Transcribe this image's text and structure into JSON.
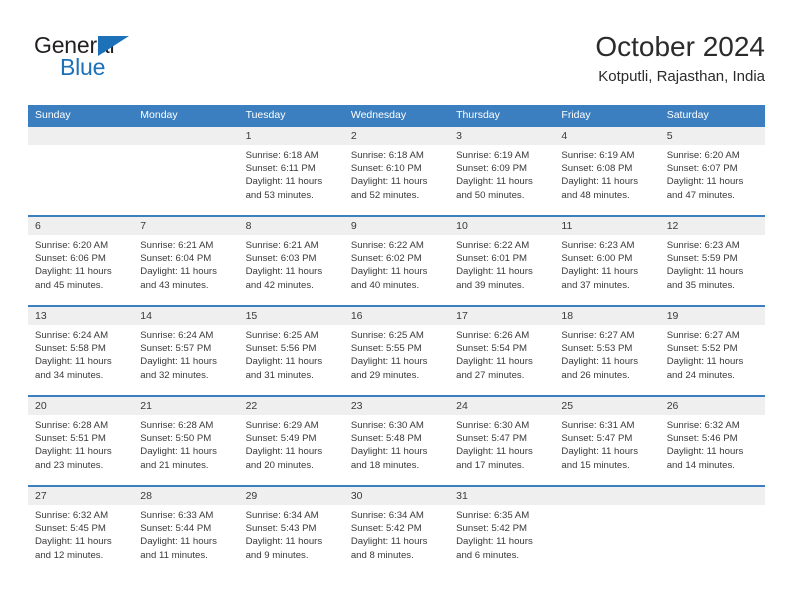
{
  "brand": {
    "name_part1": "General",
    "name_part2": "Blue",
    "color_primary": "#1c71b9"
  },
  "header": {
    "title": "October 2024",
    "subtitle": "Kotputli, Rajasthan, India"
  },
  "theme": {
    "header_blue": "#3c7fc0",
    "daynum_band": "#efefef",
    "text": "#3a3a3a"
  },
  "weekdays": [
    "Sunday",
    "Monday",
    "Tuesday",
    "Wednesday",
    "Thursday",
    "Friday",
    "Saturday"
  ],
  "weeks": [
    [
      {
        "day": "",
        "sunrise": "",
        "sunset": "",
        "daylight": ""
      },
      {
        "day": "",
        "sunrise": "",
        "sunset": "",
        "daylight": ""
      },
      {
        "day": "1",
        "sunrise": "Sunrise: 6:18 AM",
        "sunset": "Sunset: 6:11 PM",
        "daylight": "Daylight: 11 hours and 53 minutes."
      },
      {
        "day": "2",
        "sunrise": "Sunrise: 6:18 AM",
        "sunset": "Sunset: 6:10 PM",
        "daylight": "Daylight: 11 hours and 52 minutes."
      },
      {
        "day": "3",
        "sunrise": "Sunrise: 6:19 AM",
        "sunset": "Sunset: 6:09 PM",
        "daylight": "Daylight: 11 hours and 50 minutes."
      },
      {
        "day": "4",
        "sunrise": "Sunrise: 6:19 AM",
        "sunset": "Sunset: 6:08 PM",
        "daylight": "Daylight: 11 hours and 48 minutes."
      },
      {
        "day": "5",
        "sunrise": "Sunrise: 6:20 AM",
        "sunset": "Sunset: 6:07 PM",
        "daylight": "Daylight: 11 hours and 47 minutes."
      }
    ],
    [
      {
        "day": "6",
        "sunrise": "Sunrise: 6:20 AM",
        "sunset": "Sunset: 6:06 PM",
        "daylight": "Daylight: 11 hours and 45 minutes."
      },
      {
        "day": "7",
        "sunrise": "Sunrise: 6:21 AM",
        "sunset": "Sunset: 6:04 PM",
        "daylight": "Daylight: 11 hours and 43 minutes."
      },
      {
        "day": "8",
        "sunrise": "Sunrise: 6:21 AM",
        "sunset": "Sunset: 6:03 PM",
        "daylight": "Daylight: 11 hours and 42 minutes."
      },
      {
        "day": "9",
        "sunrise": "Sunrise: 6:22 AM",
        "sunset": "Sunset: 6:02 PM",
        "daylight": "Daylight: 11 hours and 40 minutes."
      },
      {
        "day": "10",
        "sunrise": "Sunrise: 6:22 AM",
        "sunset": "Sunset: 6:01 PM",
        "daylight": "Daylight: 11 hours and 39 minutes."
      },
      {
        "day": "11",
        "sunrise": "Sunrise: 6:23 AM",
        "sunset": "Sunset: 6:00 PM",
        "daylight": "Daylight: 11 hours and 37 minutes."
      },
      {
        "day": "12",
        "sunrise": "Sunrise: 6:23 AM",
        "sunset": "Sunset: 5:59 PM",
        "daylight": "Daylight: 11 hours and 35 minutes."
      }
    ],
    [
      {
        "day": "13",
        "sunrise": "Sunrise: 6:24 AM",
        "sunset": "Sunset: 5:58 PM",
        "daylight": "Daylight: 11 hours and 34 minutes."
      },
      {
        "day": "14",
        "sunrise": "Sunrise: 6:24 AM",
        "sunset": "Sunset: 5:57 PM",
        "daylight": "Daylight: 11 hours and 32 minutes."
      },
      {
        "day": "15",
        "sunrise": "Sunrise: 6:25 AM",
        "sunset": "Sunset: 5:56 PM",
        "daylight": "Daylight: 11 hours and 31 minutes."
      },
      {
        "day": "16",
        "sunrise": "Sunrise: 6:25 AM",
        "sunset": "Sunset: 5:55 PM",
        "daylight": "Daylight: 11 hours and 29 minutes."
      },
      {
        "day": "17",
        "sunrise": "Sunrise: 6:26 AM",
        "sunset": "Sunset: 5:54 PM",
        "daylight": "Daylight: 11 hours and 27 minutes."
      },
      {
        "day": "18",
        "sunrise": "Sunrise: 6:27 AM",
        "sunset": "Sunset: 5:53 PM",
        "daylight": "Daylight: 11 hours and 26 minutes."
      },
      {
        "day": "19",
        "sunrise": "Sunrise: 6:27 AM",
        "sunset": "Sunset: 5:52 PM",
        "daylight": "Daylight: 11 hours and 24 minutes."
      }
    ],
    [
      {
        "day": "20",
        "sunrise": "Sunrise: 6:28 AM",
        "sunset": "Sunset: 5:51 PM",
        "daylight": "Daylight: 11 hours and 23 minutes."
      },
      {
        "day": "21",
        "sunrise": "Sunrise: 6:28 AM",
        "sunset": "Sunset: 5:50 PM",
        "daylight": "Daylight: 11 hours and 21 minutes."
      },
      {
        "day": "22",
        "sunrise": "Sunrise: 6:29 AM",
        "sunset": "Sunset: 5:49 PM",
        "daylight": "Daylight: 11 hours and 20 minutes."
      },
      {
        "day": "23",
        "sunrise": "Sunrise: 6:30 AM",
        "sunset": "Sunset: 5:48 PM",
        "daylight": "Daylight: 11 hours and 18 minutes."
      },
      {
        "day": "24",
        "sunrise": "Sunrise: 6:30 AM",
        "sunset": "Sunset: 5:47 PM",
        "daylight": "Daylight: 11 hours and 17 minutes."
      },
      {
        "day": "25",
        "sunrise": "Sunrise: 6:31 AM",
        "sunset": "Sunset: 5:47 PM",
        "daylight": "Daylight: 11 hours and 15 minutes."
      },
      {
        "day": "26",
        "sunrise": "Sunrise: 6:32 AM",
        "sunset": "Sunset: 5:46 PM",
        "daylight": "Daylight: 11 hours and 14 minutes."
      }
    ],
    [
      {
        "day": "27",
        "sunrise": "Sunrise: 6:32 AM",
        "sunset": "Sunset: 5:45 PM",
        "daylight": "Daylight: 11 hours and 12 minutes."
      },
      {
        "day": "28",
        "sunrise": "Sunrise: 6:33 AM",
        "sunset": "Sunset: 5:44 PM",
        "daylight": "Daylight: 11 hours and 11 minutes."
      },
      {
        "day": "29",
        "sunrise": "Sunrise: 6:34 AM",
        "sunset": "Sunset: 5:43 PM",
        "daylight": "Daylight: 11 hours and 9 minutes."
      },
      {
        "day": "30",
        "sunrise": "Sunrise: 6:34 AM",
        "sunset": "Sunset: 5:42 PM",
        "daylight": "Daylight: 11 hours and 8 minutes."
      },
      {
        "day": "31",
        "sunrise": "Sunrise: 6:35 AM",
        "sunset": "Sunset: 5:42 PM",
        "daylight": "Daylight: 11 hours and 6 minutes."
      },
      {
        "day": "",
        "sunrise": "",
        "sunset": "",
        "daylight": ""
      },
      {
        "day": "",
        "sunrise": "",
        "sunset": "",
        "daylight": ""
      }
    ]
  ]
}
